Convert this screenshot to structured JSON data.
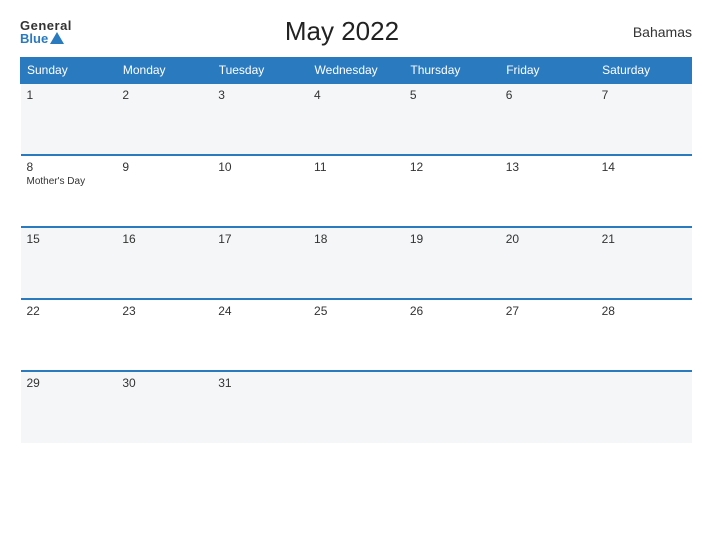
{
  "header": {
    "logo_general": "General",
    "logo_blue": "Blue",
    "title": "May 2022",
    "country": "Bahamas"
  },
  "weekdays": [
    "Sunday",
    "Monday",
    "Tuesday",
    "Wednesday",
    "Thursday",
    "Friday",
    "Saturday"
  ],
  "weeks": [
    [
      {
        "day": "1",
        "event": ""
      },
      {
        "day": "2",
        "event": ""
      },
      {
        "day": "3",
        "event": ""
      },
      {
        "day": "4",
        "event": ""
      },
      {
        "day": "5",
        "event": ""
      },
      {
        "day": "6",
        "event": ""
      },
      {
        "day": "7",
        "event": ""
      }
    ],
    [
      {
        "day": "8",
        "event": "Mother's Day"
      },
      {
        "day": "9",
        "event": ""
      },
      {
        "day": "10",
        "event": ""
      },
      {
        "day": "11",
        "event": ""
      },
      {
        "day": "12",
        "event": ""
      },
      {
        "day": "13",
        "event": ""
      },
      {
        "day": "14",
        "event": ""
      }
    ],
    [
      {
        "day": "15",
        "event": ""
      },
      {
        "day": "16",
        "event": ""
      },
      {
        "day": "17",
        "event": ""
      },
      {
        "day": "18",
        "event": ""
      },
      {
        "day": "19",
        "event": ""
      },
      {
        "day": "20",
        "event": ""
      },
      {
        "day": "21",
        "event": ""
      }
    ],
    [
      {
        "day": "22",
        "event": ""
      },
      {
        "day": "23",
        "event": ""
      },
      {
        "day": "24",
        "event": ""
      },
      {
        "day": "25",
        "event": ""
      },
      {
        "day": "26",
        "event": ""
      },
      {
        "day": "27",
        "event": ""
      },
      {
        "day": "28",
        "event": ""
      }
    ],
    [
      {
        "day": "29",
        "event": ""
      },
      {
        "day": "30",
        "event": ""
      },
      {
        "day": "31",
        "event": ""
      },
      {
        "day": "",
        "event": ""
      },
      {
        "day": "",
        "event": ""
      },
      {
        "day": "",
        "event": ""
      },
      {
        "day": "",
        "event": ""
      }
    ]
  ],
  "colors": {
    "header_bg": "#2a7abf",
    "accent": "#2a7abf"
  }
}
